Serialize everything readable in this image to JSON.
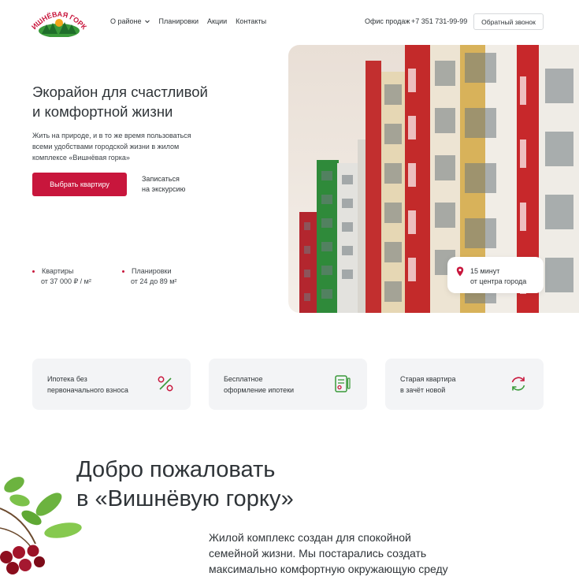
{
  "header": {
    "logo_text": "ВИШНЁВАЯ ГОРКА",
    "nav": [
      {
        "label": "О районе",
        "has_dropdown": true
      },
      {
        "label": "Планировки"
      },
      {
        "label": "Акции"
      },
      {
        "label": "Контакты"
      }
    ],
    "office_label": "Офис продаж",
    "phone": "+7 351 731-99-99",
    "callback_label": "Обратный звонок"
  },
  "hero": {
    "title_line1": "Экорайон для счастливой",
    "title_line2": "и комфортной жизни",
    "desc_line1": "Жить на природе, и в то же время пользоваться",
    "desc_line2": "всеми удобствами городской жизни в жилом",
    "desc_line3": "комплексе «Вишнёвая горка»",
    "cta_label": "Выбрать квартиру",
    "tour_line1": "Записаться",
    "tour_line2": "на экскурсию",
    "stats": [
      {
        "line1": "Квартиры",
        "line2": "от 37 000 ₽ / м²"
      },
      {
        "line1": "Планировки",
        "line2": "от 24 до 89 м²"
      }
    ],
    "time_line1": "15 минут",
    "time_line2": "от центра города"
  },
  "features": [
    {
      "line1": "Ипотека без",
      "line2": "первоначального взноса",
      "icon": "percent-icon"
    },
    {
      "line1": "Бесплатное",
      "line2": "оформление ипотеки",
      "icon": "document-icon"
    },
    {
      "line1": "Старая квартира",
      "line2": "в зачёт новой",
      "icon": "refresh-icon"
    }
  ],
  "welcome": {
    "title_line1": "Добро пожаловать",
    "title_line2": "в «Вишнёвую горку»",
    "text": "Жилой комплекс создан для спокойной семейной жизни. Мы постарались создать максимально комфортную окружающую среду для всех жильцов микрорайона."
  },
  "colors": {
    "accent": "#c8163c",
    "green": "#3a9a3a",
    "card_bg": "#f3f4f6"
  }
}
